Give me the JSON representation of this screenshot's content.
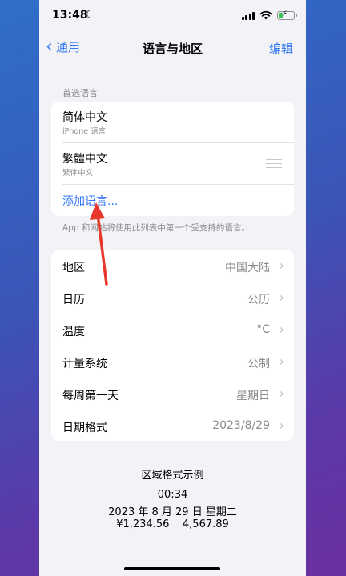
{
  "status_bar": {
    "time": "13:48",
    "moon_glyph": "☾",
    "bolt_glyph": "⚡"
  },
  "nav": {
    "back_glyph": "‹",
    "back_label": "通用",
    "title": "语言与地区",
    "edit_label": "编辑"
  },
  "languages": {
    "header": "首选语言",
    "items": [
      {
        "name": "简体中文",
        "sub": "iPhone 语言"
      },
      {
        "name": "繁體中文",
        "sub": "繁体中文"
      }
    ],
    "add_label": "添加语言...",
    "footnote": "App 和网站将使用此列表中第一个受支持的语言。"
  },
  "region_settings": {
    "chevron_glyph": "›",
    "rows": [
      {
        "label": "地区",
        "value": "中国大陆"
      },
      {
        "label": "日历",
        "value": "公历"
      },
      {
        "label": "温度",
        "value": "°C"
      },
      {
        "label": "计量系统",
        "value": "公制"
      },
      {
        "label": "每周第一天",
        "value": "星期日"
      },
      {
        "label": "日期格式",
        "value": "2023/8/29"
      }
    ]
  },
  "format_example": {
    "title": "区域格式示例",
    "time": "00:34",
    "date": "2023 年 8 月 29 日 星期二",
    "numbers": "¥1,234.56    4,567.89"
  },
  "colors": {
    "accent": "#3478f6",
    "annotation_arrow": "#e8382c"
  }
}
